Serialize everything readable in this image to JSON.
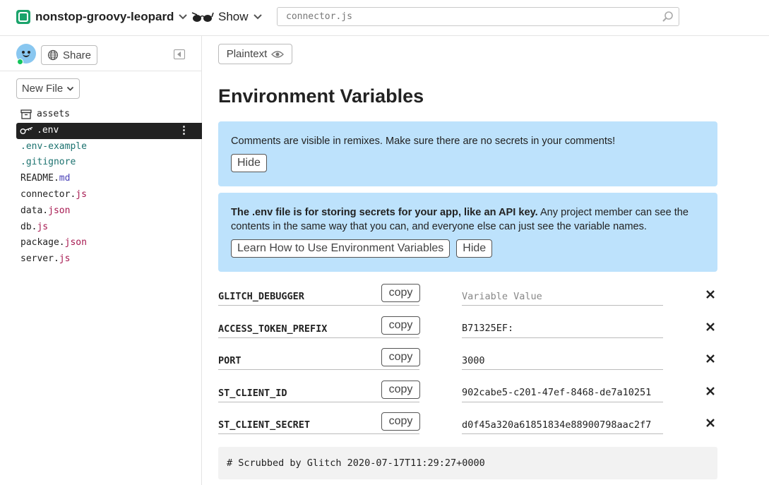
{
  "header": {
    "project_name": "nonstop-groovy-leopard",
    "show_label": "Show",
    "search_value": "connector.js"
  },
  "sidebar": {
    "share_label": "Share",
    "new_file_label": "New File",
    "files": [
      {
        "name": "assets",
        "ext": ""
      },
      {
        "name": ".env",
        "ext": ""
      },
      {
        "name": ".env-example",
        "ext": ""
      },
      {
        "name": ".gitignore",
        "ext": ""
      },
      {
        "name": "README.",
        "ext": "md"
      },
      {
        "name": "connector.",
        "ext": "js"
      },
      {
        "name": "data.",
        "ext": "json"
      },
      {
        "name": "db.",
        "ext": "js"
      },
      {
        "name": "package.",
        "ext": "json"
      },
      {
        "name": "server.",
        "ext": "js"
      }
    ],
    "more_glyph": "⋮"
  },
  "main": {
    "plaintext_label": "Plaintext",
    "title": "Environment Variables",
    "notice1": {
      "text": "Comments are visible in remixes. Make sure there are no secrets in your comments!",
      "hide_label": "Hide"
    },
    "notice2": {
      "bold_text": "The .env file is for storing secrets for your app, like an API key.",
      "text": " Any project member can see the contents in the same way that you can, and everyone else can just see the variable names.",
      "learn_label": "Learn How to Use Environment Variables",
      "hide_label": "Hide"
    },
    "copy_label": "copy",
    "value_placeholder": "Variable Value",
    "variables": [
      {
        "name": "GLITCH_DEBUGGER",
        "value": ""
      },
      {
        "name": "ACCESS_TOKEN_PREFIX",
        "value": "B71325EF:"
      },
      {
        "name": "PORT",
        "value": "3000"
      },
      {
        "name": "ST_CLIENT_ID",
        "value": "902cabe5-c201-47ef-8468-de7a10251"
      },
      {
        "name": "ST_CLIENT_SECRET",
        "value": "d0f45a320a61851834e88900798aac2f7"
      }
    ],
    "scrubbed_text": "# Scrubbed by Glitch 2020-07-17T11:29:27+0000"
  }
}
